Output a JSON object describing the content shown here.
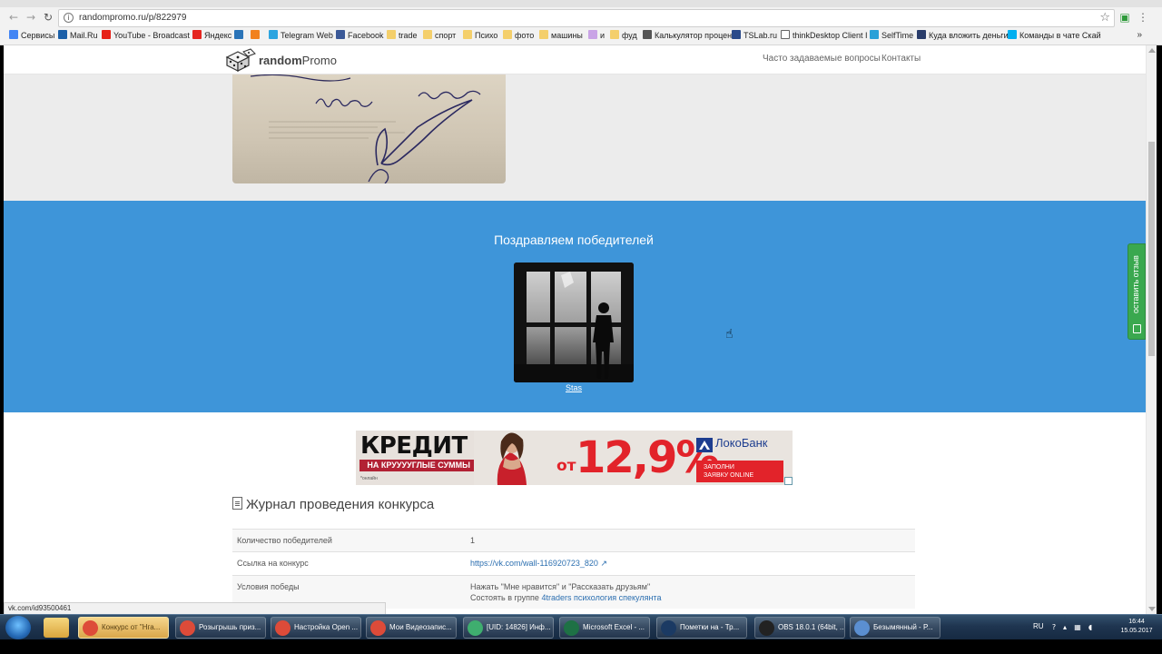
{
  "browser": {
    "url": "randompromo.ru/p/822979",
    "bookmarks": [
      {
        "label": "Сервисы",
        "color": "#4285f4"
      },
      {
        "label": "Mail.Ru",
        "color": "#1b5fa8"
      },
      {
        "label": "YouTube - Broadcast",
        "color": "#e62117"
      },
      {
        "label": "Яндекс",
        "color": "#e52620"
      },
      {
        "label": "",
        "color": "#2b74b8"
      },
      {
        "label": "",
        "color": "#f2811d"
      },
      {
        "label": "Telegram Web",
        "color": "#2ca5e0"
      },
      {
        "label": "Facebook",
        "color": "#3b5998"
      },
      {
        "label": "trade",
        "color": "#f4cf6b"
      },
      {
        "label": "спорт",
        "color": "#f4cf6b"
      },
      {
        "label": "Психо",
        "color": "#f4cf6b"
      },
      {
        "label": "фото",
        "color": "#f4cf6b"
      },
      {
        "label": "машины",
        "color": "#f4cf6b"
      },
      {
        "label": "и",
        "color": "#c9a3e6"
      },
      {
        "label": "фуд",
        "color": "#f4cf6b"
      },
      {
        "label": "Калькулятор процен",
        "color": "#555555"
      },
      {
        "label": "TSLab.ru",
        "color": "#2a4a8a"
      },
      {
        "label": "thinkDesktop Client I",
        "color": "#ffffff"
      },
      {
        "label": "SelfTime",
        "color": "#2aa1d8"
      },
      {
        "label": "Куда вложить деньги",
        "color": "#2a3d6b"
      },
      {
        "label": "Команды в чате Скай",
        "color": "#00aff0"
      }
    ],
    "bookmarks_more": "»"
  },
  "site": {
    "logo_bold": "random",
    "logo_rest": "Promo",
    "nav": [
      "Часто задаваемые вопросы",
      "Контакты"
    ]
  },
  "winners": {
    "title": "Поздравляем победителей",
    "name": "Stas"
  },
  "ad": {
    "headline": "КРЕДИТ",
    "subline": "НА КРУУУУГЛЫЕ СУММЫ",
    "small": "*онлайн",
    "prefix": "от",
    "rate": "12,9%",
    "bank": "ЛокоБанк",
    "cta_line1": "ЗАПОЛНИ",
    "cta_line2": "ЗАЯВКУ ONLINE"
  },
  "journal": {
    "title": "Журнал проведения конкурса",
    "rows": [
      {
        "key": "Количество победителей",
        "value": "1"
      },
      {
        "key": "Ссылка на конкурс",
        "value": "https://vk.com/wall-116920723_820"
      },
      {
        "key": "Условия победы",
        "value": "Нажать \"Мне нравится\" и \"Рассказать друзьям\"",
        "value2_prefix": "Состоять в группе ",
        "value2_link": "4traders психология спекулянта"
      }
    ]
  },
  "feedback_label": "оставить отзыв",
  "statusbar": "vk.com/id93500461",
  "taskbar": {
    "tasks": [
      {
        "label": "Конкурс от \"Нга...",
        "color": "#dd4b39",
        "active": true
      },
      {
        "label": "Розыгрышь приз...",
        "color": "#dd4b39",
        "active": false
      },
      {
        "label": "Настройка Open ...",
        "color": "#dd4b39",
        "active": false
      },
      {
        "label": "Мои Видеозапис...",
        "color": "#dd4b39",
        "active": false
      },
      {
        "label": "[UID: 14826] Инф...",
        "color": "#3fae6f",
        "active": false
      },
      {
        "label": "Microsoft Excel - ...",
        "color": "#1e7145",
        "active": false
      },
      {
        "label": "Пометки на - Тр...",
        "color": "#1b3a63",
        "active": false
      },
      {
        "label": "OBS 18.0.1 (64bit, ...",
        "color": "#222222",
        "active": false
      },
      {
        "label": "Безымянный - Р...",
        "color": "#5b8fd1",
        "active": false
      }
    ],
    "lang": "RU",
    "time": "16:44",
    "date": "15.05.2017"
  }
}
